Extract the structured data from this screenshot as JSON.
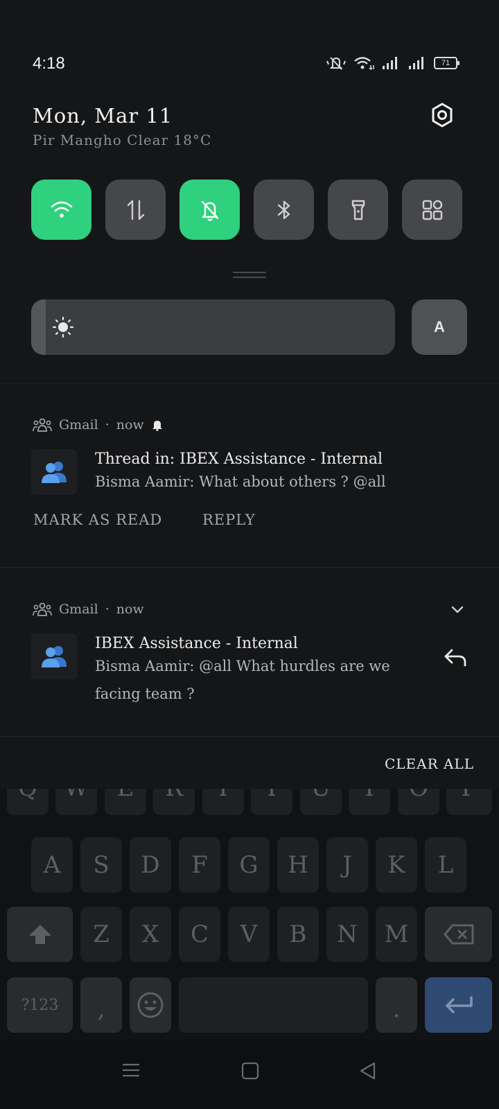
{
  "status_bar": {
    "time": "4:18",
    "battery": "71"
  },
  "header": {
    "date": "Mon, Mar 11",
    "weather": "Pir Mangho Clear 18°C"
  },
  "quick_settings": {
    "tiles": [
      {
        "name": "wifi",
        "icon": "wifi-icon",
        "active": true
      },
      {
        "name": "mobile-data",
        "icon": "data-arrows-icon",
        "active": false
      },
      {
        "name": "silent",
        "icon": "bell-off-icon",
        "active": true
      },
      {
        "name": "bluetooth",
        "icon": "bluetooth-icon",
        "active": false
      },
      {
        "name": "flashlight",
        "icon": "flashlight-icon",
        "active": false
      },
      {
        "name": "more",
        "icon": "grid-icon",
        "active": false
      }
    ],
    "brightness_level": 0.04,
    "auto_label": "A"
  },
  "notifications": [
    {
      "app": "Gmail",
      "time": "now",
      "title": "Thread in: IBEX Assistance - Internal",
      "body": "Bisma Aamir: What about others ? @all",
      "actions": [
        "MARK AS READ",
        "REPLY"
      ]
    },
    {
      "app": "Gmail",
      "time": "now",
      "title": "IBEX Assistance - Internal",
      "body_line1": "Bisma Aamir: @all What hurdles are we",
      "body_line2": "facing team ?"
    }
  ],
  "clear_all": "CLEAR ALL",
  "keyboard": {
    "top_row": [
      "Q",
      "W",
      "E",
      "R",
      "T",
      "Y",
      "U",
      "I",
      "O",
      "P"
    ],
    "middle_row": [
      "A",
      "S",
      "D",
      "F",
      "G",
      "H",
      "J",
      "K",
      "L"
    ],
    "bottom_row": [
      "Z",
      "X",
      "C",
      "V",
      "B",
      "N",
      "M"
    ],
    "symbols_key": "?123",
    "comma_key": ",",
    "period_key": "."
  },
  "colors": {
    "accent": "#2fd07e",
    "enter": "#2f4a72"
  }
}
